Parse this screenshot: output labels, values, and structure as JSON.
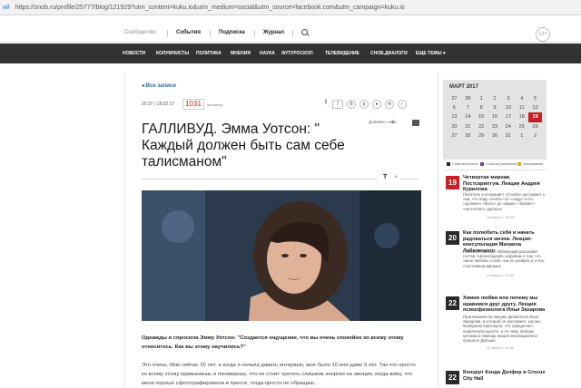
{
  "browser": {
    "fragment": "ий",
    "url": "https://snob.ru/profile/25777/blog/121929?utm_content=kuku.io&utm_medium=social&utm_source=facebook.com&utm_campaign=kuku.io"
  },
  "topnav": {
    "items": [
      "Сообщество",
      "События",
      "Подписка",
      "Журнал"
    ],
    "age": "18+"
  },
  "rubrics": [
    "НОВОСТИ",
    "КОЛУМНИСТЫ",
    "ПОЛИТИКА",
    "МНЕНИЯ",
    "НАУКА",
    "ФУТУРОСКОП",
    "ТЕЛЕВИДЕНИЕ",
    "СНОБ.ДИАЛОГИ",
    "ЕЩЕ ТЕМЫ ▾"
  ],
  "post": {
    "back_label": "◂ Все записи",
    "date": "20:37 / 18.02.17",
    "views": "1031",
    "views_label": "просмотр",
    "share_count": "7",
    "share_buttons": [
      "f",
      "B",
      "g",
      "●",
      "✉",
      "✓"
    ],
    "favorites_label": "Добавить себе",
    "favorites_plus": "+",
    "title": "ГАЛЛИВУД. Эмма Уотсон: \" Каждый должен быть сам себе талисманом\"",
    "font_t": "T",
    "font_plus": "+",
    "intro": "Однажды я спросила Эмму Уотсон: \"Создается ощущение, что вы очень спокойно ко всему этому относитесь. Как вы этому научились?\"",
    "body": "Это очень. Мне сейчас 20 лет, а когда я начала давать интервью, мне было 10 или даже 9 лет. Так что просто ко всему этому привыкаешь и понимаешь, что не стоит тратить слишком энергии на эмоции, когда вижу, что меня хорошо сфотографировали в прессе, тогда просто не обращаю..."
  },
  "calendar": {
    "month": "МАРТ 2017",
    "rows": [
      [
        "27",
        "28",
        "1",
        "2",
        "3",
        "4",
        "5"
      ],
      [
        "6",
        "7",
        "8",
        "9",
        "10",
        "11",
        "12"
      ],
      [
        "13",
        "14",
        "15",
        "16",
        "17",
        "18",
        "19"
      ],
      [
        "20",
        "21",
        "22",
        "23",
        "24",
        "25",
        "26"
      ],
      [
        "27",
        "28",
        "29",
        "30",
        "31",
        "1",
        "2"
      ]
    ],
    "highlight": "19",
    "legend": [
      "События проекта",
      "События участников",
      "Приглашения"
    ]
  },
  "events": [
    {
      "day": "19",
      "title": "Четвертая мирная. Постскриптум. Лекция Андрея Курилова",
      "text": "Писатель и колумнист «Сноба» расскажет о том, что надо «знать» по «ходу» и кто «должен» «быть» до «мира» «бывает» «интеллект» Дальше",
      "meta": "19 марта / 15:00",
      "color": "#c82026"
    },
    {
      "day": "20",
      "title": "Как полюбить себя и начать радоваться жизни. Лекция-консультация Михаила Лабковского",
      "text": "Психолог Михаил Лабковский расскажет гостям «Шоколадной» кофейни о том, что такое любовь к себе, как ее развить и стать счастливым Дальше",
      "meta": "20 марта / 19:00",
      "color": "#2a2a2a"
    },
    {
      "day": "22",
      "title": "Химия любви или почему мы нравимся друг другу. Лекция психофизиолога Ильи Захарова",
      "text": "Приглашаем на лекцию физиолога Ильи Захарова, в которой он расскажет, как мы выбираем партнеров, что определяет привлекательность, и по чему любовь мучима в помощь нашей эволюционное прошлое Дальше",
      "meta": "22 марта / 19:30",
      "color": "#2a2a2a"
    },
    {
      "day": "22",
      "title": "Концерт Кэнди Дэлфер в Crocus City Hall",
      "text": "",
      "meta": "",
      "color": "#2a2a2a"
    }
  ]
}
